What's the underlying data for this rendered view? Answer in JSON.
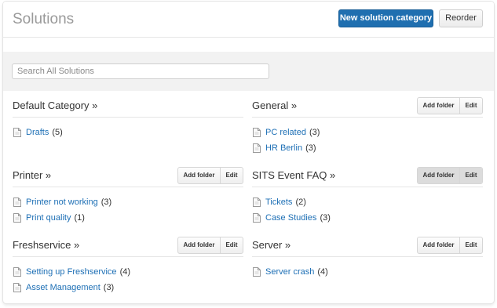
{
  "header": {
    "title": "Solutions",
    "new_category_label": "New solution category",
    "reorder_label": "Reorder"
  },
  "search": {
    "placeholder": "Search All Solutions",
    "value": ""
  },
  "actions": {
    "add_folder_label": "Add folder",
    "edit_label": "Edit"
  },
  "categories": [
    {
      "title": "Default Category »",
      "has_actions": false,
      "folders": [
        {
          "name": "Drafts",
          "count": "(5)"
        }
      ]
    },
    {
      "title": "General »",
      "has_actions": true,
      "folders": [
        {
          "name": "PC related",
          "count": "(3)"
        },
        {
          "name": "HR Berlin",
          "count": "(3)"
        }
      ]
    },
    {
      "title": "Printer »",
      "has_actions": true,
      "folders": [
        {
          "name": "Printer not working",
          "count": "(3)"
        },
        {
          "name": "Print quality",
          "count": "(1)"
        }
      ]
    },
    {
      "title": "SITS Event FAQ »",
      "has_actions": true,
      "actions_highlighted": true,
      "folders": [
        {
          "name": "Tickets",
          "count": "(2)"
        },
        {
          "name": "Case Studies",
          "count": "(3)"
        }
      ]
    },
    {
      "title": "Freshservice »",
      "has_actions": true,
      "folders": [
        {
          "name": "Setting up Freshservice",
          "count": "(4)"
        },
        {
          "name": "Asset Management",
          "count": "(3)"
        }
      ]
    },
    {
      "title": "Server »",
      "has_actions": true,
      "folders": [
        {
          "name": "Server crash",
          "count": "(4)"
        }
      ]
    }
  ],
  "colors": {
    "primary_button": "#1f6fb0",
    "link": "#1d6fb5",
    "search_band": "#f2f2f2"
  },
  "icons": {
    "folder_item": "document-icon"
  }
}
